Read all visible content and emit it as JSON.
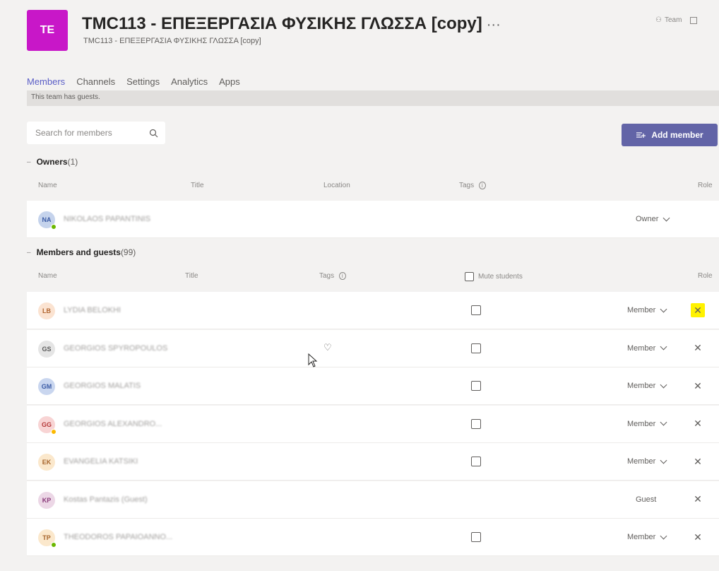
{
  "team": {
    "avatar": "TE",
    "avatar_color": "#c817c8",
    "title": "TMC113 - ΕΠΕΞΕΡΓΑΣΙΑ ΦΥΣΙΚΗΣ ΓΛΩΣΣΑ [copy]",
    "ellipsis": "···",
    "subtitle": "TMC113 - ΕΠΕΞΕΡΓΑΣΙΑ ΦΥΣΙΚΗΣ ΓΛΩΣΣΑ [copy]",
    "pill_label": "Team"
  },
  "tabs": [
    "Members",
    "Channels",
    "Settings",
    "Analytics",
    "Apps"
  ],
  "banner": "This team has guests.",
  "search": {
    "placeholder": "Search for members"
  },
  "add_member": {
    "label": "Add member",
    "color": "#6264a7"
  },
  "owners": {
    "title": "Owners",
    "count": "(1)",
    "columns": {
      "name": "Name",
      "title": "Title",
      "location": "Location",
      "tags": "Tags",
      "role": "Role"
    },
    "rows": [
      {
        "initials": "NA",
        "name": "NIKOLAOS PAPANTINIS",
        "role": "Owner",
        "avatar_bg": "#c5d3ec",
        "avatar_fg": "#3b5ba5",
        "status": "#6bb700"
      }
    ]
  },
  "members": {
    "title": "Members and guests",
    "count": "(99)",
    "columns": {
      "name": "Name",
      "title": "Title",
      "tags": "Tags",
      "mute": "Mute students",
      "role": "Role"
    },
    "rows": [
      {
        "initials": "LB",
        "name": "LYDIA BELOKHI",
        "role": "Member",
        "checkbox": true,
        "avatar_bg": "#fbe3d1",
        "avatar_fg": "#b0652f",
        "status": "",
        "close_highlight": true
      },
      {
        "initials": "GS",
        "name": "GEORGIOS SPYROPOULOS",
        "role": "Member",
        "checkbox": true,
        "avatar_bg": "#e5e5e5",
        "avatar_fg": "#5a5a5a",
        "status": "",
        "close_highlight": false
      },
      {
        "initials": "GM",
        "name": "GEORGIOS MALATIS",
        "role": "Member",
        "checkbox": true,
        "avatar_bg": "#c9d6ef",
        "avatar_fg": "#3b5ba5",
        "status": "",
        "close_highlight": false
      },
      {
        "initials": "GG",
        "name": "GEORGIOS ALEXANDRO...",
        "role": "Member",
        "checkbox": true,
        "avatar_bg": "#f8d4d4",
        "avatar_fg": "#b63a3a",
        "status": "#fcb900",
        "close_highlight": false
      },
      {
        "initials": "EK",
        "name": "EVANGELIA KATSIKI",
        "role": "Member",
        "checkbox": true,
        "avatar_bg": "#fbe8cc",
        "avatar_fg": "#a6642a",
        "status": "",
        "close_highlight": false
      },
      {
        "initials": "KP",
        "name": "Kostas Pantazis (Guest)",
        "role": "Guest",
        "checkbox": false,
        "avatar_bg": "#ecd7e6",
        "avatar_fg": "#8a3a7a",
        "status": "",
        "close_highlight": false
      },
      {
        "initials": "TP",
        "name": "THEODOROS PAPAIOANNO...",
        "role": "Member",
        "checkbox": true,
        "avatar_bg": "#fbe8cc",
        "avatar_fg": "#a6642a",
        "status": "#6bb700",
        "close_highlight": false
      }
    ]
  }
}
